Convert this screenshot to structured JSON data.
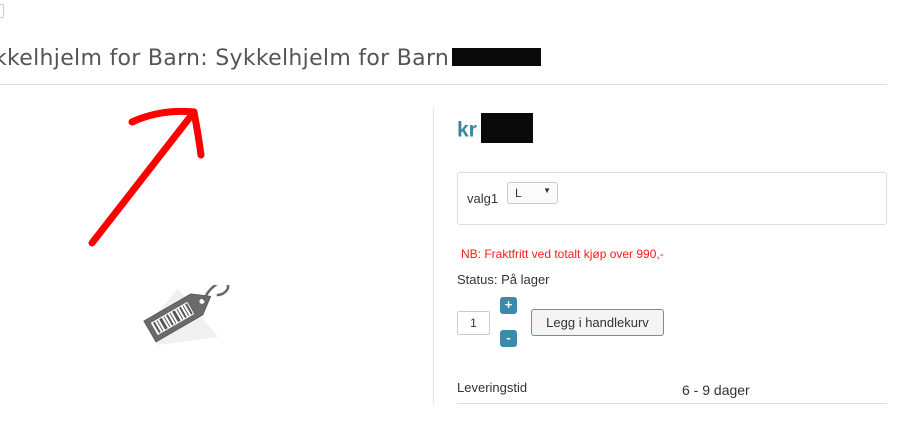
{
  "product": {
    "title": "kkelhjelm for Barn: Sykkelhjelm for Barn",
    "price_prefix": "kr"
  },
  "icons": {
    "annotation": "red-arrow-annotation",
    "product_placeholder": "price-tag-barcode-icon"
  },
  "options": {
    "label": "valg1",
    "selected": "L"
  },
  "notice": {
    "shipping": "NB: Fraktfritt ved totalt kjøp over 990,-",
    "status": "Status: På lager"
  },
  "cart": {
    "quantity": "1",
    "plus": "+",
    "minus": "-",
    "add_label": "Legg i handlekurv"
  },
  "delivery": {
    "label": "Leveringstid",
    "value": "6 - 9 dager"
  },
  "colors": {
    "accent": "#3b86a3",
    "notice": "#ff1a1a",
    "annotation": "#ff0000"
  }
}
